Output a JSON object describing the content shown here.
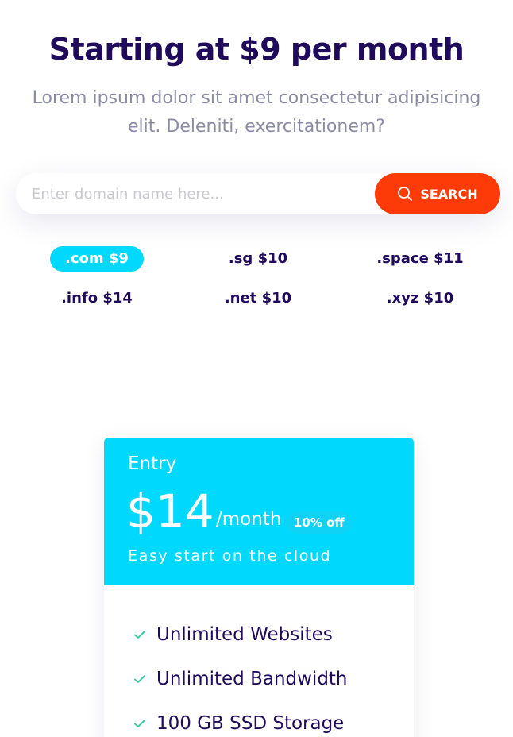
{
  "hero": {
    "title": "Starting at $9 per month",
    "subtitle_line1": "Lorem ipsum dolor sit amet consectetur adipisicing",
    "subtitle_line2": "elit. Deleniti, exercitationem?"
  },
  "search": {
    "placeholder": "Enter domain name here...",
    "button_label": "SEARCH"
  },
  "tlds": [
    {
      "label": ".com $9",
      "selected": true
    },
    {
      "label": ".sg $10"
    },
    {
      "label": ".space $11"
    },
    {
      "label": ".info $14"
    },
    {
      "label": ".net $10"
    },
    {
      "label": ".xyz $10"
    }
  ],
  "plan": {
    "name": "Entry",
    "price": "$14",
    "period": "/month",
    "discount": "10% off",
    "tagline": "Easy start on the cloud",
    "features": [
      "Unlimited Websites",
      "Unlimited Bandwidth",
      "100 GB SSD Storage"
    ]
  },
  "colors": {
    "heading": "#1f0a5c",
    "muted_text": "#8b8ba3",
    "accent_cyan": "#00d8fd",
    "search_button": "#fc3b08",
    "check_green": "#2fc79a"
  },
  "icons": {
    "search_button": "search-icon",
    "feature_bullet": "check-icon"
  }
}
